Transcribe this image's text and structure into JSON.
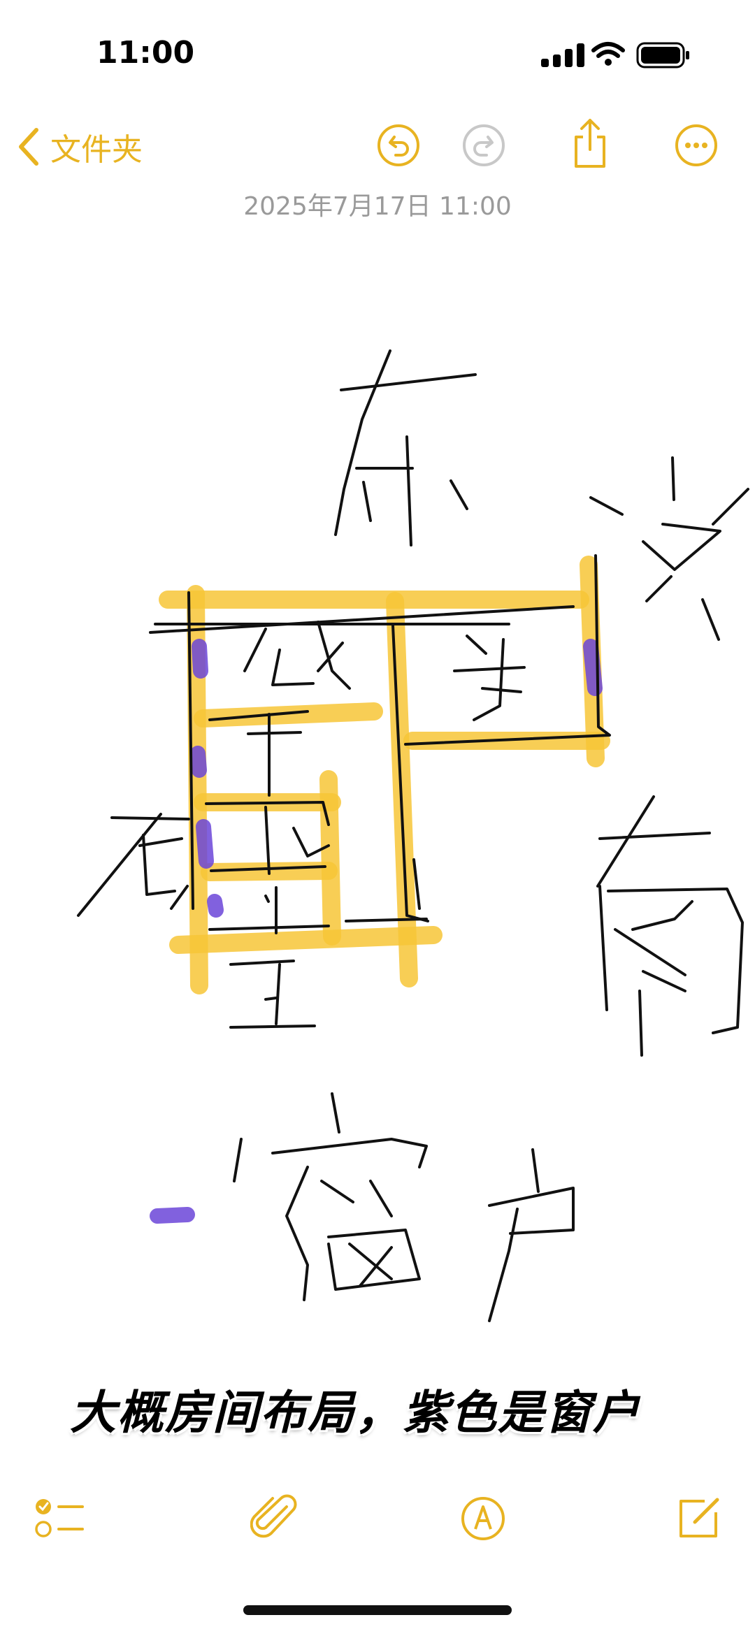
{
  "status_bar": {
    "time": "11:00"
  },
  "nav": {
    "back_label": "文件夹"
  },
  "note": {
    "date": "2025年7月17日 11:00",
    "caption": "大概房间布局，紫色是窗户"
  },
  "colors": {
    "accent": "#E8B321",
    "highlighter": "#F7C637",
    "window_marker": "#6B45D8",
    "ink": "#111111"
  },
  "icons": {
    "back": "chevron-left-icon",
    "undo": "undo-icon",
    "redo": "redo-icon",
    "share": "share-icon",
    "more": "ellipsis-circle-icon",
    "checklist": "checklist-icon",
    "attach": "paperclip-icon",
    "markup": "pen-tip-icon",
    "compose": "compose-icon"
  }
}
